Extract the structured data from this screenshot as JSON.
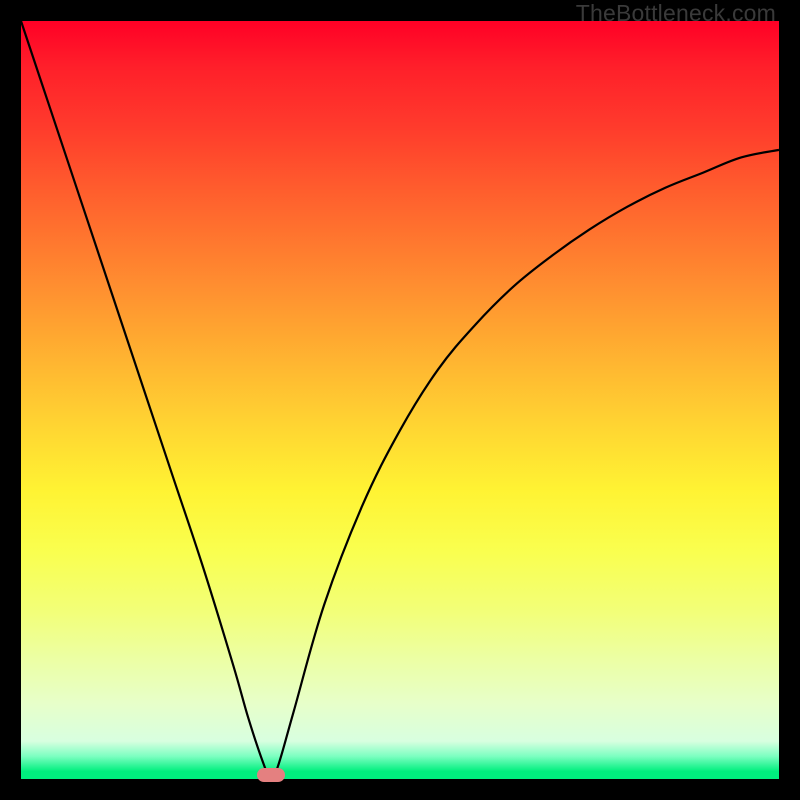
{
  "watermark": "TheBottleneck.com",
  "colors": {
    "frame": "#000000",
    "gradient_top": "#ff0026",
    "gradient_bottom": "#00ef7e",
    "marker": "#e48080",
    "curve": "#000000"
  },
  "chart_data": {
    "type": "line",
    "title": "",
    "xlabel": "",
    "ylabel": "",
    "xlim": [
      0,
      100
    ],
    "ylim": [
      0,
      100
    ],
    "x_min_point": 33,
    "series": [
      {
        "name": "bottleneck-curve",
        "x": [
          0,
          4,
          8,
          12,
          16,
          20,
          24,
          28,
          30,
          32,
          33,
          34,
          36,
          40,
          45,
          50,
          55,
          60,
          65,
          70,
          75,
          80,
          85,
          90,
          95,
          100
        ],
        "y": [
          100,
          88,
          76,
          64,
          52,
          40,
          28,
          15,
          8,
          2,
          0,
          2,
          9,
          23,
          36,
          46,
          54,
          60,
          65,
          69,
          72.5,
          75.5,
          78,
          80,
          82,
          83
        ]
      }
    ],
    "marker": {
      "x": 33,
      "y": 0
    },
    "annotations": []
  }
}
